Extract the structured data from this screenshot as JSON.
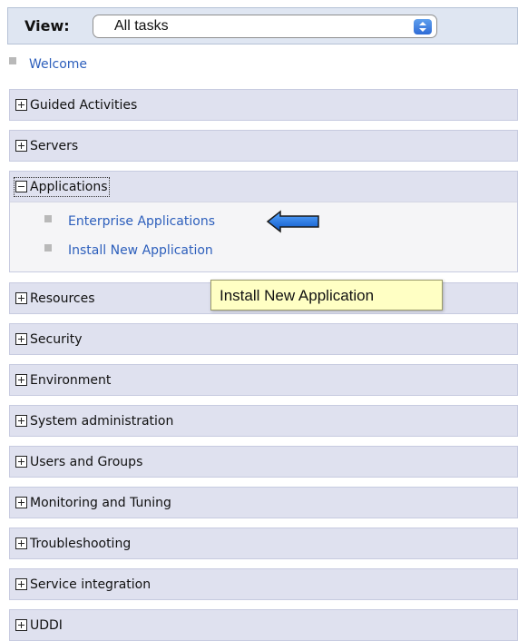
{
  "view": {
    "label": "View:",
    "selected": "All tasks"
  },
  "welcome": {
    "label": "Welcome"
  },
  "nav": {
    "sections": [
      {
        "title": "Guided Activities"
      },
      {
        "title": "Servers"
      },
      {
        "title": "Applications"
      },
      {
        "title": "Resources"
      },
      {
        "title": "Security"
      },
      {
        "title": "Environment"
      },
      {
        "title": "System administration"
      },
      {
        "title": "Users and Groups"
      },
      {
        "title": "Monitoring and Tuning"
      },
      {
        "title": "Troubleshooting"
      },
      {
        "title": "Service integration"
      },
      {
        "title": "UDDI"
      }
    ],
    "applications_items": [
      {
        "label": "Enterprise Applications"
      },
      {
        "label": "Install New Application"
      }
    ]
  },
  "tooltip": {
    "text": "Install New Application"
  },
  "colors": {
    "link": "#2d5fbc",
    "section_bg": "#dfe1ef",
    "tooltip_bg": "#ffffc4",
    "arrow": "#1f6fe0"
  },
  "icons": {
    "collapsed": "plus-box-icon",
    "expanded": "minus-box-icon",
    "bullet": "square-bullet-icon",
    "select": "select-arrows-icon",
    "pointer": "left-arrow-icon"
  }
}
